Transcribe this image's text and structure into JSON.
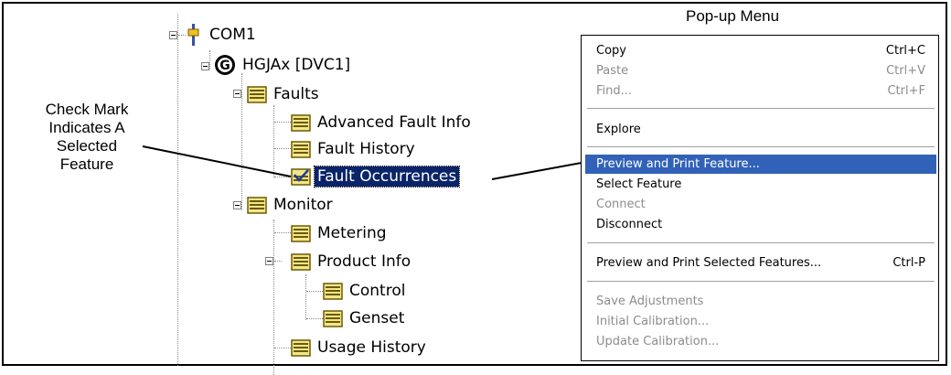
{
  "tree": {
    "com_label": "COM1",
    "device_label": "HGJAx [DVC1]",
    "faults_label": "Faults",
    "advanced_fault_info": "Advanced Fault Info",
    "fault_history": "Fault History",
    "fault_occurrences": "Fault Occurrences",
    "monitor_label": "Monitor",
    "metering": "Metering",
    "product_info": "Product Info",
    "control": "Control",
    "genset": "Genset",
    "usage_history": "Usage History"
  },
  "callout": {
    "line1": "Check Mark",
    "line2": "Indicates A",
    "line3": "Selected",
    "line4": "Feature"
  },
  "menu": {
    "title": "Pop-up Menu",
    "items": [
      {
        "label": "Copy",
        "shortcut": "Ctrl+C"
      },
      {
        "label": "Paste",
        "shortcut": "Ctrl+V"
      },
      {
        "label": "Find...",
        "shortcut": "Ctrl+F"
      },
      {
        "label": "Explore",
        "shortcut": ""
      },
      {
        "label": "Preview and Print Feature...",
        "shortcut": ""
      },
      {
        "label": "Select Feature",
        "shortcut": ""
      },
      {
        "label": "Connect",
        "shortcut": ""
      },
      {
        "label": "Disconnect",
        "shortcut": ""
      },
      {
        "label": "Preview and Print Selected Features...",
        "shortcut": "Ctrl-P"
      },
      {
        "label": "Save Adjustments",
        "shortcut": ""
      },
      {
        "label": "Initial Calibration...",
        "shortcut": ""
      },
      {
        "label": "Update Calibration...",
        "shortcut": ""
      }
    ]
  },
  "colors": {
    "highlight": "#3162b8",
    "selection": "#0a246a",
    "folder_fill": "#f4e68c",
    "folder_stroke": "#6b5a00",
    "disabled_text": "#8c8c8c"
  },
  "icons": [
    "minus-expander-icon",
    "com-port-icon",
    "device-g-icon",
    "folder-icon",
    "checked-folder-icon"
  ]
}
